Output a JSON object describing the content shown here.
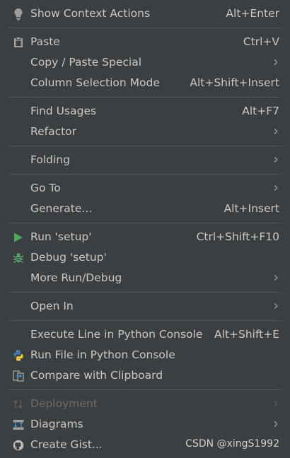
{
  "menu": {
    "items": [
      {
        "label": "Show Context Actions",
        "shortcut": "Alt+Enter",
        "icon": "lightbulb-icon"
      },
      {
        "label": "Paste",
        "shortcut": "Ctrl+V",
        "icon": "clipboard-icon"
      },
      {
        "label": "Copy / Paste Special",
        "submenu": true
      },
      {
        "label": "Column Selection Mode",
        "shortcut": "Alt+Shift+Insert"
      },
      {
        "label": "Find Usages",
        "shortcut": "Alt+F7"
      },
      {
        "label": "Refactor",
        "submenu": true
      },
      {
        "label": "Folding",
        "submenu": true
      },
      {
        "label": "Go To",
        "submenu": true
      },
      {
        "label": "Generate...",
        "shortcut": "Alt+Insert"
      },
      {
        "label": "Run 'setup'",
        "shortcut": "Ctrl+Shift+F10",
        "icon": "run-icon"
      },
      {
        "label": "Debug 'setup'",
        "icon": "debug-bug-icon"
      },
      {
        "label": "More Run/Debug",
        "submenu": true
      },
      {
        "label": "Open In",
        "submenu": true
      },
      {
        "label": "Execute Line in Python Console",
        "shortcut": "Alt+Shift+E"
      },
      {
        "label": "Run File in Python Console",
        "icon": "python-icon"
      },
      {
        "label": "Compare with Clipboard",
        "icon": "compare-icon"
      },
      {
        "label": "Deployment",
        "submenu": true,
        "disabled": true,
        "icon": "deployment-icon"
      },
      {
        "label": "Diagrams",
        "submenu": true,
        "icon": "diagrams-icon"
      },
      {
        "label": "Create Gist...",
        "icon": "github-icon"
      }
    ]
  },
  "watermark": "CSDN @xingS1992",
  "colors": {
    "background": "#3c3f41",
    "text": "#c8c8c8",
    "disabled_text": "#6b6b6b",
    "separator": "#515658",
    "run_green": "#4fa75a",
    "debug_green": "#59a869"
  }
}
